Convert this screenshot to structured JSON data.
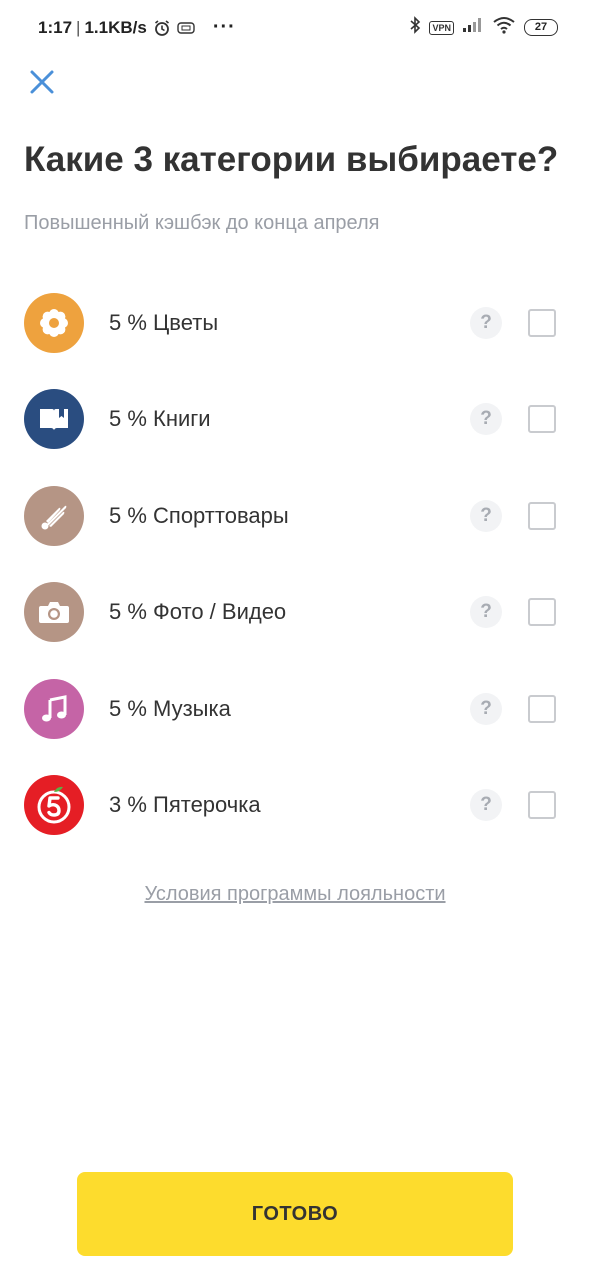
{
  "status_bar": {
    "time": "1:17",
    "separator": "|",
    "speed": "1.1KB/s",
    "more": "···",
    "vpn": "VPN",
    "battery": "27"
  },
  "header": {
    "close_icon": "close-icon",
    "title": "Какие 3 категории выбираете?",
    "subtitle": "Повышенный кэшбэк до конца апреля"
  },
  "categories": [
    {
      "label": "5 % Цветы",
      "icon": "flower-icon",
      "color": "#eea23e",
      "help": "?"
    },
    {
      "label": "5 % Книги",
      "icon": "book-icon",
      "color": "#2a4d80",
      "help": "?"
    },
    {
      "label": "5 % Спорттовары",
      "icon": "shuttlecock-icon",
      "color": "#b59585",
      "help": "?"
    },
    {
      "label": "5 % Фото / Видео",
      "icon": "camera-icon",
      "color": "#b59585",
      "help": "?"
    },
    {
      "label": "5 % Музыка",
      "icon": "music-note-icon",
      "color": "#c564a6",
      "help": "?"
    },
    {
      "label": "3 % Пятерочка",
      "icon": "pyaterochka-logo-icon",
      "color": "#e51e25",
      "help": "?"
    }
  ],
  "footer": {
    "loyalty_link": "Условия программы лояльности",
    "done_button": "ГОТОВО"
  },
  "colors": {
    "accent_yellow": "#fddc2d",
    "close_blue": "#4a90d9",
    "muted_text": "#9a9ea6"
  }
}
